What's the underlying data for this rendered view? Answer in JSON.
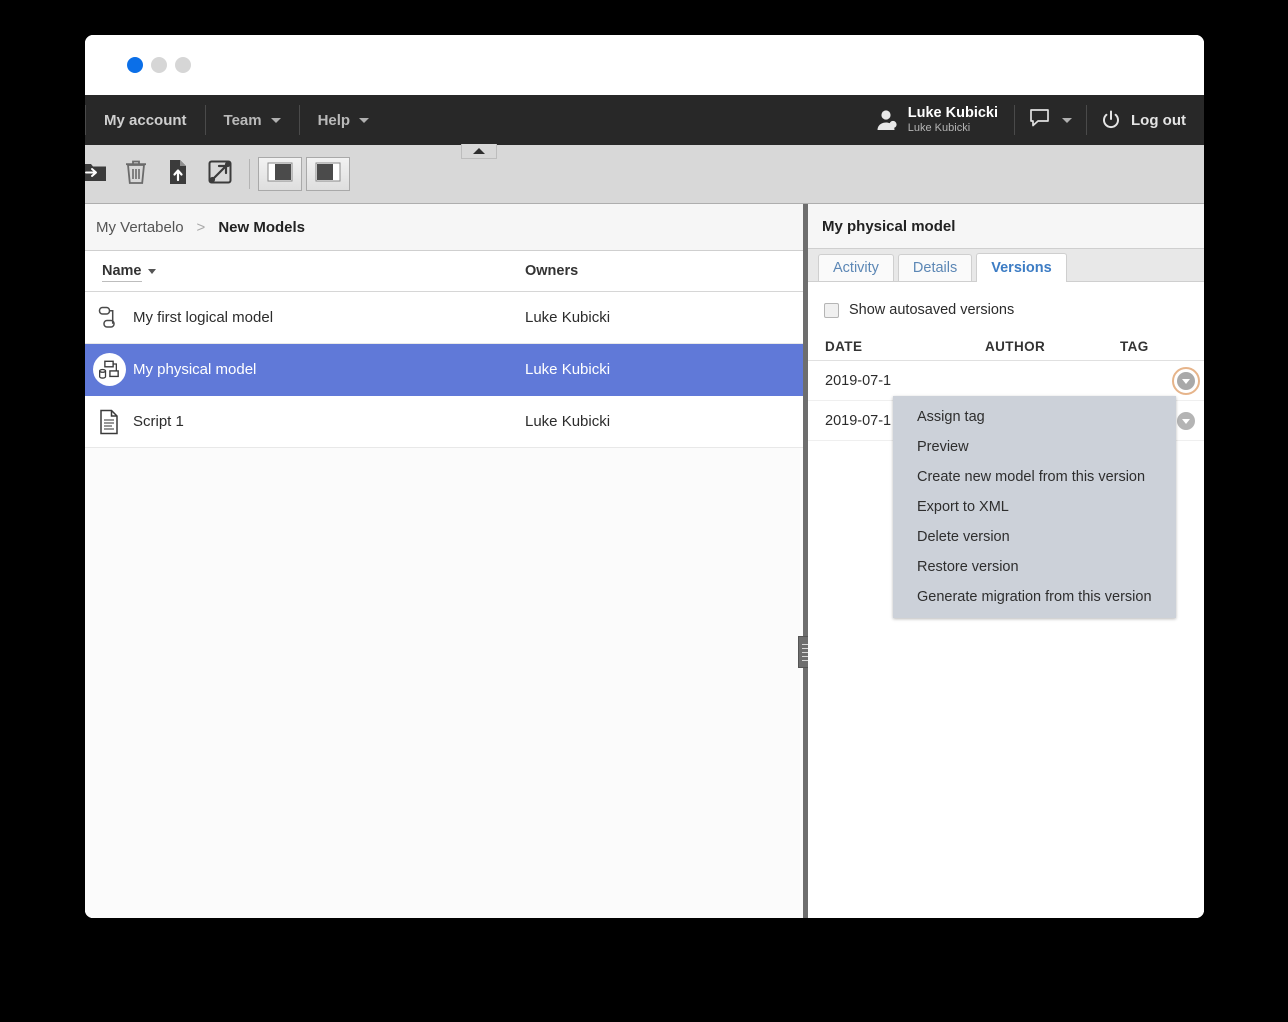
{
  "browser": {
    "dots": [
      "active",
      "idle",
      "idle"
    ]
  },
  "topnav": {
    "items": [
      {
        "label": "My account",
        "icon": "",
        "has_caret": false
      },
      {
        "label": "Team",
        "icon": "chevron-down-icon",
        "has_caret": true
      },
      {
        "label": "Help",
        "icon": "chevron-down-icon",
        "has_caret": true
      }
    ],
    "user": {
      "icon": "user-avatar-icon",
      "name": "Luke Kubicki",
      "subname": "Luke Kubicki"
    },
    "chat": {
      "icon": "chat-bubble-icon",
      "has_caret": true
    },
    "logout": {
      "icon": "power-icon",
      "label": "Log out"
    }
  },
  "toolbar": {
    "buttons": [
      {
        "name": "move-to-folder-icon",
        "title": "Move to folder"
      },
      {
        "name": "delete-icon",
        "title": "Delete"
      },
      {
        "name": "upload-file-icon",
        "title": "Upload"
      },
      {
        "name": "share-icon",
        "title": "Share"
      }
    ],
    "layout_buttons": [
      {
        "name": "layout-left-split-icon",
        "title": "Left split layout"
      },
      {
        "name": "layout-right-split-icon",
        "title": "Right split layout"
      }
    ],
    "collapse": {
      "name": "collapse-toolbar-icon",
      "title": "Collapse toolbar"
    }
  },
  "breadcrumb": {
    "root": "My Vertabelo",
    "separator": ">",
    "current": "New Models"
  },
  "file_table": {
    "columns": {
      "name": "Name",
      "owners": "Owners"
    },
    "sort_indicator": "descending",
    "rows": [
      {
        "icon": "logical-model-icon",
        "name": "My first logical model",
        "owner": "Luke Kubicki",
        "selected": false
      },
      {
        "icon": "physical-model-icon",
        "name": "My physical model",
        "owner": "Luke Kubicki",
        "selected": true
      },
      {
        "icon": "script-icon",
        "name": "Script 1",
        "owner": "Luke Kubicki",
        "selected": false
      }
    ]
  },
  "right_panel": {
    "title": "My physical model",
    "tabs": [
      {
        "label": "Activity",
        "active": false
      },
      {
        "label": "Details",
        "active": false
      },
      {
        "label": "Versions",
        "active": true
      }
    ],
    "autosaved": {
      "label": "Show autosaved versions",
      "checked": false
    },
    "versions_table": {
      "columns": {
        "date": "DATE",
        "author": "AUTHOR",
        "tag": "TAG"
      },
      "rows": [
        {
          "date": "2019-07-1",
          "author": "",
          "tag": "",
          "menu_focused": true
        },
        {
          "date": "2019-07-1",
          "author": "",
          "tag": "",
          "menu_focused": false
        }
      ]
    }
  },
  "context_menu": {
    "items": [
      "Assign tag",
      "Preview",
      "Create new model from this version",
      "Export to XML",
      "Delete version",
      "Restore version",
      "Generate migration from this version"
    ]
  },
  "colors": {
    "nav_dark": "#282828",
    "selected_row": "#6079d8",
    "tab_active_text": "#3c7cc4",
    "menu_bg": "#ccd1d9",
    "focus_ring": "#e6b48a",
    "dot_active": "#0b6fe8"
  }
}
